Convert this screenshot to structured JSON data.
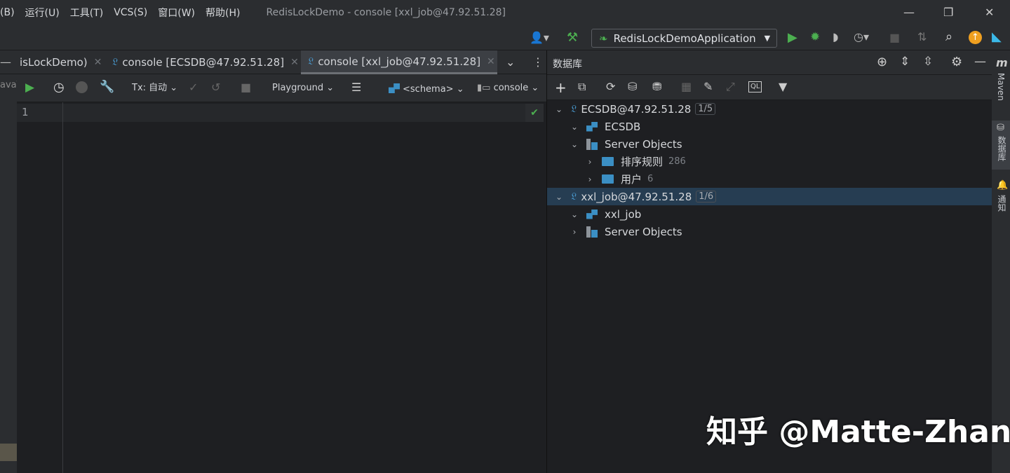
{
  "menu": [
    "(B)",
    "运行(U)",
    "工具(T)",
    "VCS(S)",
    "窗口(W)",
    "帮助(H)"
  ],
  "window_title": "RedisLockDemo - console [xxl_job@47.92.51.28]",
  "run_config": "RedisLockDemoApplication",
  "tabs": [
    {
      "label": "isLockDemo)"
    },
    {
      "label": "console [ECSDB@47.92.51.28]"
    },
    {
      "label": "console [xxl_job@47.92.51.28]",
      "active": true
    }
  ],
  "left_strip_text": "ava\\",
  "editor_toolbar": {
    "tx": "Tx: 自动",
    "playground": "Playground",
    "schema": "<schema>",
    "console": "console"
  },
  "editor": {
    "line_number": "1"
  },
  "db_panel": {
    "title": "数据库",
    "tree": [
      {
        "label": "ECSDB@47.92.51.28",
        "badge": "1/5"
      },
      {
        "label": "ECSDB"
      },
      {
        "label": "Server Objects"
      },
      {
        "label": "排序规则",
        "count": "286"
      },
      {
        "label": "用户",
        "count": "6"
      },
      {
        "label": "xxl_job@47.92.51.28",
        "badge": "1/6"
      },
      {
        "label": "xxl_job"
      },
      {
        "label": "Server Objects"
      }
    ]
  },
  "right_strip": {
    "maven": "Maven",
    "database": "数据库",
    "notifications": "通知"
  },
  "watermark": "知乎 @Matte-Zhang"
}
